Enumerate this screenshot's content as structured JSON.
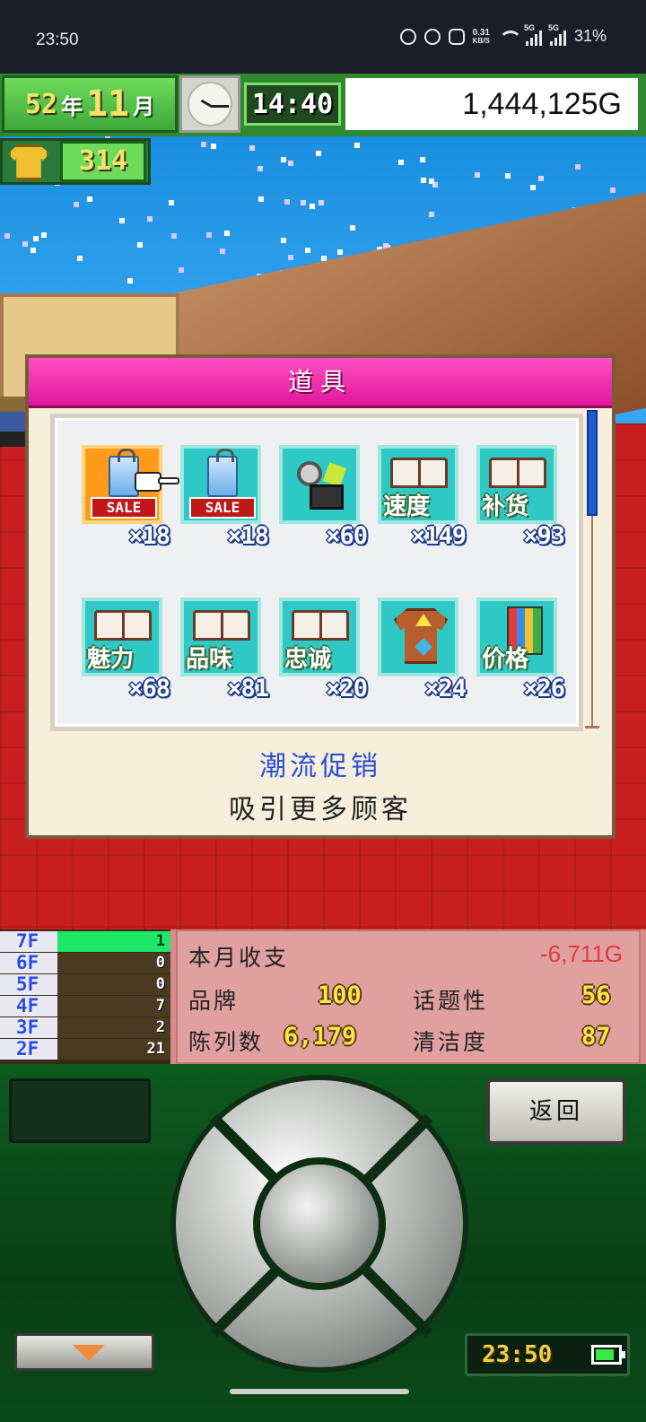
{
  "status_bar": {
    "time": "23:50",
    "net_speed_value": "0.31",
    "net_speed_unit": "KB/S",
    "sig1_label": "5G",
    "sig2_label": "5G",
    "battery_text": "31%"
  },
  "hud": {
    "year": "52",
    "year_unit": "年",
    "month": "11",
    "month_unit": "月",
    "game_time": "14:40",
    "money": "1,444,125G",
    "shirt_count": "314"
  },
  "dialog": {
    "title": "道具",
    "scroll_position": 0.0,
    "items": [
      {
        "icon": "sale-bag-icon",
        "tag": "SALE",
        "count": "×18",
        "selected": true
      },
      {
        "icon": "sale-bag-icon",
        "tag": "SALE",
        "count": "×18",
        "selected": false
      },
      {
        "icon": "camera-icon",
        "count": "×60"
      },
      {
        "icon": "book-icon",
        "label": "速度",
        "count": "×149"
      },
      {
        "icon": "book-icon",
        "label": "补货",
        "count": "×93"
      },
      {
        "icon": "book-icon",
        "label": "魅力",
        "count": "×68"
      },
      {
        "icon": "book-icon",
        "label": "品味",
        "count": "×81"
      },
      {
        "icon": "book-icon",
        "label": "忠诚",
        "count": "×20"
      },
      {
        "icon": "shirt-upgrade-icon",
        "count": "×24"
      },
      {
        "icon": "book-icon",
        "label": "价格",
        "count": "×26"
      }
    ],
    "desc_title": "潮流促销",
    "desc_text": "吸引更多顾客"
  },
  "floors": [
    {
      "name": "7F",
      "value": "1",
      "active": true
    },
    {
      "name": "6F",
      "value": "0"
    },
    {
      "name": "5F",
      "value": "0"
    },
    {
      "name": "4F",
      "value": "7"
    },
    {
      "name": "3F",
      "value": "2"
    },
    {
      "name": "2F",
      "value": "21"
    }
  ],
  "stats": {
    "monthly_label": "本月收支",
    "monthly_value": "-6,711G",
    "brand_label": "品牌",
    "brand_value": "100",
    "topic_label": "话题性",
    "topic_value": "56",
    "display_label": "陈列数",
    "display_value": "6,179",
    "clean_label": "清洁度",
    "clean_value": "87"
  },
  "controller": {
    "back_label": "返回",
    "device_time": "23:50",
    "battery_level": 0.75
  },
  "colors": {
    "accent_pink": "#e0179c",
    "hud_green": "#2f8a2f",
    "tile_cyan": "#2ec9c4",
    "selected_orange": "#ff9a1a",
    "desc_blue": "#2a4fd8",
    "negative_red": "#e23a3a"
  }
}
